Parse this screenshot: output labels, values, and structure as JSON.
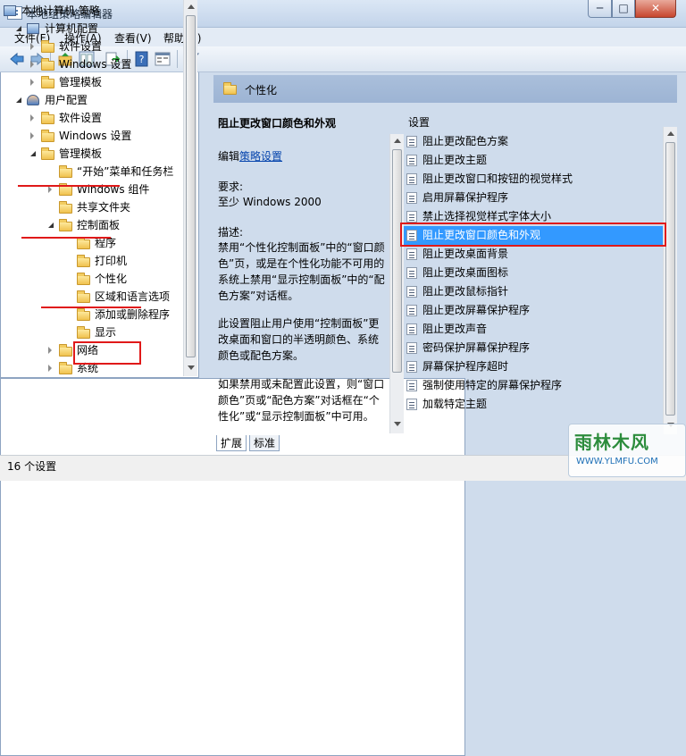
{
  "window": {
    "title": "本地组策略编辑器",
    "min_glyph": "─",
    "max_glyph": "□",
    "close_glyph": "✕"
  },
  "menu": [
    "文件(F)",
    "操作(A)",
    "查看(V)",
    "帮助(H)"
  ],
  "toolbar": {
    "icons": [
      "back-icon",
      "forward-icon",
      "up-folder-icon",
      "show-hide-tree-icon",
      "export-icon",
      "help-icon",
      "properties-icon",
      "filter-icon"
    ]
  },
  "tree": [
    {
      "label": "本地计算机 策略",
      "level": 0,
      "expand": "none",
      "icon": "computer-policy-icon"
    },
    {
      "label": "计算机配置",
      "level": 1,
      "expand": "open",
      "icon": "computer-icon"
    },
    {
      "label": "软件设置",
      "level": 2,
      "expand": "closed",
      "icon": "folder-icon"
    },
    {
      "label": "Windows 设置",
      "level": 2,
      "expand": "closed",
      "icon": "folder-icon"
    },
    {
      "label": "管理模板",
      "level": 2,
      "expand": "closed",
      "icon": "folder-icon"
    },
    {
      "label": "用户配置",
      "level": 1,
      "expand": "open",
      "icon": "user-icon"
    },
    {
      "label": "软件设置",
      "level": 2,
      "expand": "closed",
      "icon": "folder-icon"
    },
    {
      "label": "Windows 设置",
      "level": 2,
      "expand": "closed",
      "icon": "folder-icon"
    },
    {
      "label": "管理模板",
      "level": 2,
      "expand": "open",
      "icon": "folder-icon"
    },
    {
      "label": "“开始”菜单和任务栏",
      "level": 3,
      "expand": "none",
      "icon": "folder-icon"
    },
    {
      "label": "Windows 组件",
      "level": 3,
      "expand": "closed",
      "icon": "folder-icon"
    },
    {
      "label": "共享文件夹",
      "level": 3,
      "expand": "none",
      "icon": "folder-icon"
    },
    {
      "label": "控制面板",
      "level": 3,
      "expand": "open",
      "icon": "folder-icon"
    },
    {
      "label": "程序",
      "level": 4,
      "expand": "none",
      "icon": "folder-icon"
    },
    {
      "label": "打印机",
      "level": 4,
      "expand": "none",
      "icon": "folder-icon"
    },
    {
      "label": "个性化",
      "level": 4,
      "expand": "none",
      "icon": "folder-icon",
      "selected": true
    },
    {
      "label": "区域和语言选项",
      "level": 4,
      "expand": "none",
      "icon": "folder-icon"
    },
    {
      "label": "添加或删除程序",
      "level": 4,
      "expand": "none",
      "icon": "folder-icon"
    },
    {
      "label": "显示",
      "level": 4,
      "expand": "none",
      "icon": "folder-icon"
    },
    {
      "label": "网络",
      "level": 3,
      "expand": "closed",
      "icon": "folder-icon"
    },
    {
      "label": "系统",
      "level": 3,
      "expand": "closed",
      "icon": "folder-icon"
    }
  ],
  "header": {
    "title": "个性化"
  },
  "description": {
    "title": "阻止更改窗口颜色和外观",
    "edit_prefix": "编辑",
    "edit_link": "策略设置",
    "req_label": "要求:",
    "req_value": "至少 Windows 2000",
    "desc_label": "描述:",
    "paragraphs": [
      "禁用“个性化控制面板”中的“窗口颜色”页，或是在个性化功能不可用的系统上禁用“显示控制面板”中的“配色方案”对话框。",
      "此设置阻止用户使用“控制面板”更改桌面和窗口的半透明颜色、系统颜色或配色方案。",
      "如果禁用或未配置此设置，则“窗口颜色”页或“配色方案”对话框在“个性化”或“显示控制面板”中可用。"
    ]
  },
  "settings": {
    "column_header": "设置",
    "items": [
      "阻止更改配色方案",
      "阻止更改主题",
      "阻止更改窗口和按钮的视觉样式",
      "启用屏幕保护程序",
      "禁止选择视觉样式字体大小",
      "阻止更改窗口颜色和外观",
      "阻止更改桌面背景",
      "阻止更改桌面图标",
      "阻止更改鼠标指针",
      "阻止更改屏幕保护程序",
      "阻止更改声音",
      "密码保护屏幕保护程序",
      "屏幕保护程序超时",
      "强制使用特定的屏幕保护程序",
      "加载特定主题"
    ],
    "selected_index": 5
  },
  "tabs": [
    "扩展",
    "标准"
  ],
  "status": {
    "text": "16 个设置"
  },
  "watermark": {
    "brand": "雨林木风",
    "url": "WWW.YLMFU.COM"
  },
  "colors": {
    "accent_red": "#e01919",
    "selection": "#3399ff",
    "header": "#9db4d4"
  }
}
